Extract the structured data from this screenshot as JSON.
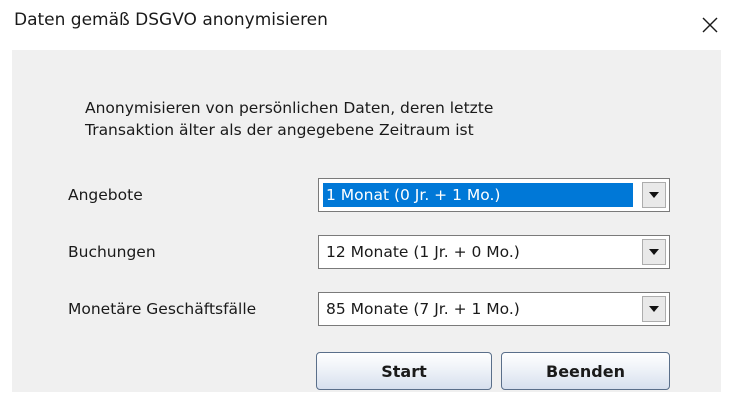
{
  "window": {
    "title": "Daten gemäß DSGVO anonymisieren",
    "close_icon": "close-icon"
  },
  "description": {
    "line1": "Anonymisieren von persönlichen Daten, deren letzte",
    "line2": "Transaktion älter als der angegebene Zeitraum ist"
  },
  "rows": [
    {
      "label": "Angebote",
      "value": "1 Monat (0 Jr. + 1 Mo.)",
      "focused": true
    },
    {
      "label": "Buchungen",
      "value": "12 Monate (1 Jr. + 0 Mo.)",
      "focused": false
    },
    {
      "label": "Monetäre Geschäftsfälle",
      "value": "85 Monate (7 Jr. + 1 Mo.)",
      "focused": false
    }
  ],
  "buttons": {
    "start": "Start",
    "close": "Beenden"
  },
  "colors": {
    "selection": "#0078d7",
    "dialog_background": "#f0f0f0"
  }
}
